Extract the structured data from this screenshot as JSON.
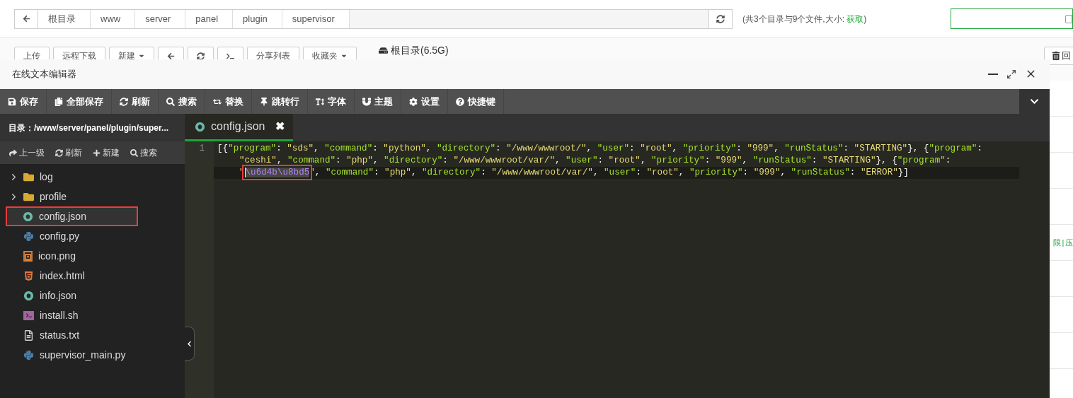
{
  "breadcrumb": {
    "items": [
      "根目录",
      "www",
      "server",
      "panel",
      "plugin",
      "supervisor"
    ]
  },
  "summary": {
    "text": "(共3个目录与9个文件,大小: ",
    "link": "获取",
    "close": ")"
  },
  "search_checkbox": {
    "checked": false
  },
  "file_toolbar": {
    "buttons": [
      {
        "kind": "text",
        "label": "上传"
      },
      {
        "kind": "text",
        "label": "远程下载"
      },
      {
        "kind": "dropdown",
        "label": "新建"
      },
      {
        "kind": "back"
      },
      {
        "kind": "refresh"
      },
      {
        "kind": "terminal"
      },
      {
        "kind": "text",
        "label": "分享列表"
      },
      {
        "kind": "dropdown",
        "label": "收藏夹"
      }
    ],
    "disk": "根目录(6.5G)",
    "recycle": "回"
  },
  "file_table": {
    "visible_cell": "限 | 压"
  },
  "editor": {
    "title": "在线文本编辑器",
    "toolbar": [
      {
        "kind": "save",
        "label": "保存"
      },
      {
        "kind": "save_all",
        "label": "全部保存"
      },
      {
        "kind": "refresh",
        "label": "刷新"
      },
      {
        "kind": "search",
        "label": "搜索"
      },
      {
        "kind": "replace",
        "label": "替换"
      },
      {
        "kind": "goto",
        "label": "跳转行"
      },
      {
        "kind": "font",
        "label": "字体"
      },
      {
        "kind": "theme",
        "label": "主题"
      },
      {
        "kind": "settings",
        "label": "设置"
      },
      {
        "kind": "shortcuts",
        "label": "快捷键"
      }
    ],
    "directory": "目录：/www/server/panel/plugin/super...",
    "sidebar_actions": [
      {
        "kind": "up",
        "label": "上一级"
      },
      {
        "kind": "refresh",
        "label": "刷新"
      },
      {
        "kind": "new",
        "label": "新建"
      },
      {
        "kind": "search",
        "label": "搜索"
      }
    ],
    "files": [
      {
        "kind": "folder",
        "name": "log",
        "expanded": false,
        "selected": false
      },
      {
        "kind": "folder",
        "name": "profile",
        "expanded": false,
        "selected": false
      },
      {
        "kind": "json",
        "name": "config.json",
        "selected": true
      },
      {
        "kind": "python",
        "name": "config.py",
        "selected": false
      },
      {
        "kind": "image",
        "name": "icon.png",
        "selected": false
      },
      {
        "kind": "html",
        "name": "index.html",
        "selected": false
      },
      {
        "kind": "json",
        "name": "info.json",
        "selected": false
      },
      {
        "kind": "shell",
        "name": "install.sh",
        "selected": false
      },
      {
        "kind": "text",
        "name": "status.txt",
        "selected": false
      },
      {
        "kind": "python",
        "name": "supervisor_main.py",
        "selected": false
      }
    ],
    "tabs": [
      {
        "kind": "json",
        "label": "config.json",
        "close": "✖",
        "selected": true
      }
    ],
    "code": {
      "line_number": "1",
      "visual_lines": [
        [
          {
            "kind": "punct",
            "text": "[{"
          },
          {
            "kind": "key",
            "text": "\"program\""
          },
          {
            "kind": "punct",
            "text": ": "
          },
          {
            "kind": "string",
            "text": "\"sds\""
          },
          {
            "kind": "punct",
            "text": ", "
          },
          {
            "kind": "key",
            "text": "\"command\""
          },
          {
            "kind": "punct",
            "text": ": "
          },
          {
            "kind": "string",
            "text": "\"python\""
          },
          {
            "kind": "punct",
            "text": ", "
          },
          {
            "kind": "key",
            "text": "\"directory\""
          },
          {
            "kind": "punct",
            "text": ": "
          },
          {
            "kind": "string",
            "text": "\"/www/wwwroot/\""
          },
          {
            "kind": "punct",
            "text": ", "
          },
          {
            "kind": "key",
            "text": "\"user\""
          },
          {
            "kind": "punct",
            "text": ": "
          },
          {
            "kind": "string",
            "text": "\"root\""
          },
          {
            "kind": "punct",
            "text": ", "
          },
          {
            "kind": "key",
            "text": "\"priority\""
          },
          {
            "kind": "punct",
            "text": ": "
          },
          {
            "kind": "string",
            "text": "\"999\""
          },
          {
            "kind": "punct",
            "text": ", "
          },
          {
            "kind": "key",
            "text": "\"runStatus\""
          },
          {
            "kind": "punct",
            "text": ": "
          },
          {
            "kind": "string",
            "text": "\"STARTING\""
          },
          {
            "kind": "punct",
            "text": "}, {"
          },
          {
            "kind": "key",
            "text": "\"program\""
          },
          {
            "kind": "punct",
            "text": ":"
          }
        ],
        [
          {
            "kind": "string",
            "text": "\"ceshi\""
          },
          {
            "kind": "punct",
            "text": ", "
          },
          {
            "kind": "key",
            "text": "\"command\""
          },
          {
            "kind": "punct",
            "text": ": "
          },
          {
            "kind": "string",
            "text": "\"php\""
          },
          {
            "kind": "punct",
            "text": ", "
          },
          {
            "kind": "key",
            "text": "\"directory\""
          },
          {
            "kind": "punct",
            "text": ": "
          },
          {
            "kind": "string",
            "text": "\"/www/wwwroot/var/\""
          },
          {
            "kind": "punct",
            "text": ", "
          },
          {
            "kind": "key",
            "text": "\"user\""
          },
          {
            "kind": "punct",
            "text": ": "
          },
          {
            "kind": "string",
            "text": "\"root\""
          },
          {
            "kind": "punct",
            "text": ", "
          },
          {
            "kind": "key",
            "text": "\"priority\""
          },
          {
            "kind": "punct",
            "text": ": "
          },
          {
            "kind": "string",
            "text": "\"999\""
          },
          {
            "kind": "punct",
            "text": ", "
          },
          {
            "kind": "key",
            "text": "\"runStatus\""
          },
          {
            "kind": "punct",
            "text": ": "
          },
          {
            "kind": "string",
            "text": "\"STARTING\""
          },
          {
            "kind": "punct",
            "text": "}, {"
          },
          {
            "kind": "key",
            "text": "\"program\""
          },
          {
            "kind": "punct",
            "text": ":"
          }
        ],
        [
          {
            "kind": "string",
            "text": "\""
          },
          {
            "kind": "selected_escape",
            "text": "\\u6d4b\\u8bd5"
          },
          {
            "kind": "string",
            "text": "\""
          },
          {
            "kind": "punct",
            "text": ", "
          },
          {
            "kind": "key",
            "text": "\"command\""
          },
          {
            "kind": "punct",
            "text": ": "
          },
          {
            "kind": "string",
            "text": "\"php\""
          },
          {
            "kind": "punct",
            "text": ", "
          },
          {
            "kind": "key",
            "text": "\"directory\""
          },
          {
            "kind": "punct",
            "text": ": "
          },
          {
            "kind": "string",
            "text": "\"/www/wwwroot/var/\""
          },
          {
            "kind": "punct",
            "text": ", "
          },
          {
            "kind": "key",
            "text": "\"user\""
          },
          {
            "kind": "punct",
            "text": ": "
          },
          {
            "kind": "string",
            "text": "\"root\""
          },
          {
            "kind": "punct",
            "text": ", "
          },
          {
            "kind": "key",
            "text": "\"priority\""
          },
          {
            "kind": "punct",
            "text": ": "
          },
          {
            "kind": "string",
            "text": "\"999\""
          },
          {
            "kind": "punct",
            "text": ", "
          },
          {
            "kind": "key",
            "text": "\"runStatus\""
          },
          {
            "kind": "punct",
            "text": ": "
          },
          {
            "kind": "string",
            "text": "\"ERROR\""
          },
          {
            "kind": "punct",
            "text": "}]"
          }
        ]
      ]
    }
  }
}
